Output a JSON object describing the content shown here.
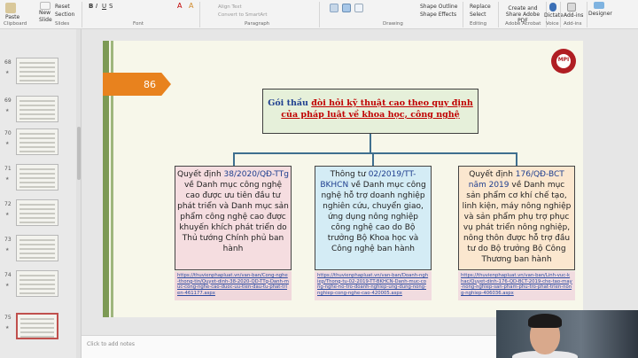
{
  "ribbon": {
    "paste": "Paste",
    "new_slide": "New\nSlide",
    "reset": "Reset",
    "section": "Section",
    "align_text": "Align Text",
    "convert_smartart": "Convert to SmartArt",
    "shape_outline": "Shape Outline",
    "shape_effects": "Shape Effects",
    "replace": "Replace",
    "select": "Select",
    "create_share_pdf": "Create and Share Adobe PDF",
    "dictate": "Dictate",
    "add_ins": "Add-ins",
    "designer": "Designer",
    "groups": {
      "clipboard": "Clipboard",
      "slides": "Slides",
      "font": "Font",
      "paragraph": "Paragraph",
      "drawing": "Drawing",
      "editing": "Editing",
      "adobe_acrobat": "Adobe Acrobat",
      "voice": "Voice",
      "add_ins": "Add-ins"
    }
  },
  "thumbnails": [
    {
      "num": "68"
    },
    {
      "num": "69"
    },
    {
      "num": "70"
    },
    {
      "num": "71"
    },
    {
      "num": "72"
    },
    {
      "num": "73"
    },
    {
      "num": "74"
    },
    {
      "num": "75",
      "selected": true
    }
  ],
  "slide": {
    "number": "86",
    "logo_text": "MPI",
    "title_part1": "Gói thầu ",
    "title_part2": "đòi hỏi kỹ thuật cao theo quy định",
    "title_part3": "của pháp luật về khoa học, công nghệ",
    "box1_pre": "Quyết định ",
    "box1_hl": "38/2020/QĐ-TTg",
    "box1_text": " về Danh mục công nghệ cao được ưu tiên đầu tư phát triển và Danh mục sản phẩm công nghệ cao được khuyến khích phát triển do Thủ tướng Chính phủ ban hành",
    "box2_pre": "Thông tư ",
    "box2_hl": "02/2019/TT-BKHCN",
    "box2_text": " về Danh mục công nghệ hỗ trợ doanh nghiệp nghiên cứu, chuyển giao, ứng dụng nông nghiệp công nghệ cao do Bộ trưởng Bộ Khoa học và Công nghệ ban hành",
    "box3_pre": "Quyết định ",
    "box3_hl": "176/QĐ-BCT năm 2019",
    "box3_text": " về Danh mục sản phẩm cơ khí chế tạo, linh kiện, máy nông nghiệp và sản phẩm phụ trợ phục vụ phát triển nông nghiệp, nông thôn được hỗ trợ đầu tư do Bộ trưởng Bộ Công Thương ban hành",
    "link1": "https://thuvienphapluat.vn/van-ban/Cong-nghe-thong-tin/Quyet-dinh-38-2020-QD-TTg-Danh-muc-cong-nghe-cao-duoc-uu-tien-dau-tu-phat-trien-461177.aspx",
    "link2": "https://thuvienphapluat.vn/van-ban/Doanh-nghiep/Thong-tu-02-2019-TT-BKHCN-Danh-muc-cong-nghe-ho-tro-doanh-nghiep-ung-dung-nong-nghiep-cong-nghe-cao-420005.aspx",
    "link3": "https://thuvienphapluat.vn/van-ban/Linh-vuc-khac/Quyet-dinh-176-QD-BCT-2019-che-tao-may-nong-nghiep-san-pham-phu-tro-phat-trien-nong-nghiep-406036.aspx"
  },
  "notes_placeholder": "Click to add notes",
  "colors": {
    "accent_orange": "#e8821e",
    "title_blue": "#1f3f8f",
    "title_red": "#c00000",
    "box1": "#f5dde0",
    "box2": "#d4ecf5",
    "box3": "#fbe7cf",
    "title_box": "#e6f0da"
  }
}
